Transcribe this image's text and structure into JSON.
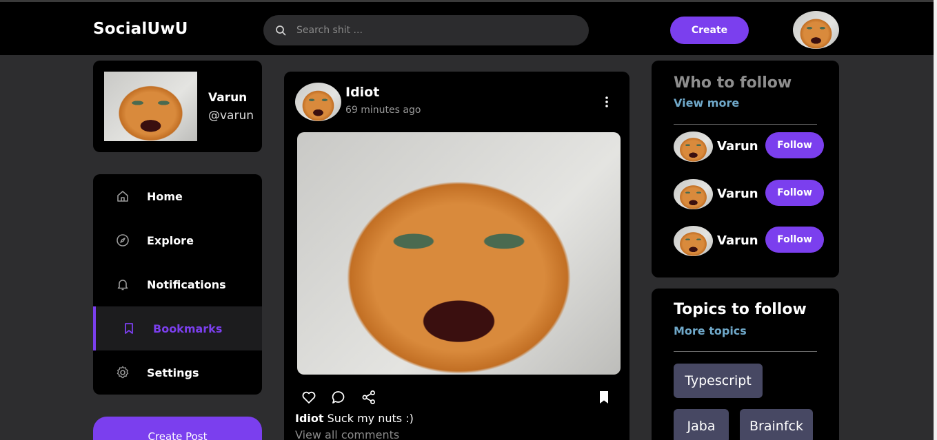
{
  "app": {
    "logo": "SocialUwU"
  },
  "header": {
    "search_placeholder": "Search shit ...",
    "create_label": "Create",
    "search_icon": "search-icon",
    "avatar": "cat-avatar"
  },
  "profile": {
    "name": "Varun",
    "handle": "@varun"
  },
  "sidebar": {
    "items": [
      {
        "label": "Home",
        "icon": "home-icon"
      },
      {
        "label": "Explore",
        "icon": "compass-icon"
      },
      {
        "label": "Notifications",
        "icon": "bell-icon"
      },
      {
        "label": "Bookmarks",
        "icon": "bookmark-icon",
        "active": true
      },
      {
        "label": "Settings",
        "icon": "gear-icon"
      }
    ],
    "create_post_label": "Create Post"
  },
  "post": {
    "author": "Idiot",
    "time": "69 minutes ago",
    "caption_author": "Idiot",
    "caption_text": " Suck my nuts :)",
    "view_comments": "View all comments"
  },
  "who_to_follow": {
    "title": "Who to follow",
    "view_more": "View more",
    "follow_label": "Follow",
    "users": [
      {
        "name": "Varun"
      },
      {
        "name": "Varun"
      },
      {
        "name": "Varun"
      }
    ]
  },
  "topics": {
    "title": "Topics to follow",
    "more": "More topics",
    "chips": [
      "Typescript",
      "Jaba",
      "Brainfck"
    ]
  },
  "colors": {
    "accent": "#7b3fee",
    "link": "#6fa8c9",
    "chip": "#474863"
  }
}
